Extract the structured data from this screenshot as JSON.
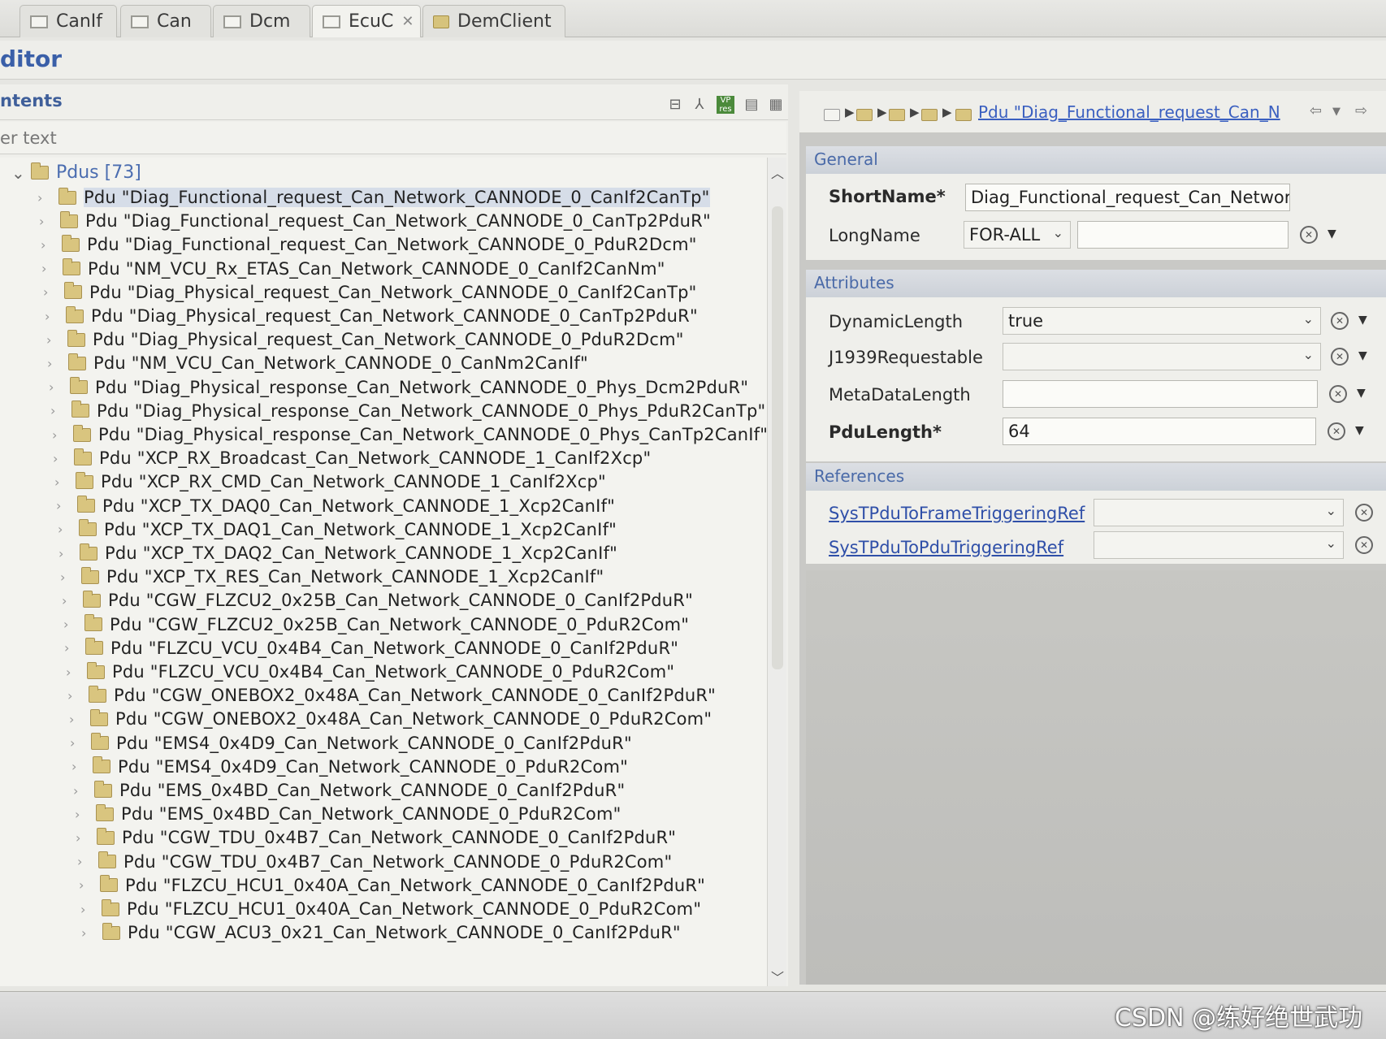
{
  "tabs": [
    {
      "label": "CanIf"
    },
    {
      "label": "Can"
    },
    {
      "label": "Dcm"
    },
    {
      "label": "EcuC"
    },
    {
      "label": "DemClient"
    }
  ],
  "editor_title": "ditor",
  "left_panel": {
    "title": "ntents",
    "filter_placeholder": "er text",
    "root": {
      "label": "Pdus [73]"
    },
    "items": [
      "Pdu \"Diag_Functional_request_Can_Network_CANNODE_0_CanIf2CanTp\"",
      "Pdu \"Diag_Functional_request_Can_Network_CANNODE_0_CanTp2PduR\"",
      "Pdu \"Diag_Functional_request_Can_Network_CANNODE_0_PduR2Dcm\"",
      "Pdu \"NM_VCU_Rx_ETAS_Can_Network_CANNODE_0_CanIf2CanNm\"",
      "Pdu \"Diag_Physical_request_Can_Network_CANNODE_0_CanIf2CanTp\"",
      "Pdu \"Diag_Physical_request_Can_Network_CANNODE_0_CanTp2PduR\"",
      "Pdu \"Diag_Physical_request_Can_Network_CANNODE_0_PduR2Dcm\"",
      "Pdu \"NM_VCU_Can_Network_CANNODE_0_CanNm2CanIf\"",
      "Pdu \"Diag_Physical_response_Can_Network_CANNODE_0_Phys_Dcm2PduR\"",
      "Pdu \"Diag_Physical_response_Can_Network_CANNODE_0_Phys_PduR2CanTp\"",
      "Pdu \"Diag_Physical_response_Can_Network_CANNODE_0_Phys_CanTp2CanIf\"",
      "Pdu \"XCP_RX_Broadcast_Can_Network_CANNODE_1_CanIf2Xcp\"",
      "Pdu \"XCP_RX_CMD_Can_Network_CANNODE_1_CanIf2Xcp\"",
      "Pdu \"XCP_TX_DAQ0_Can_Network_CANNODE_1_Xcp2CanIf\"",
      "Pdu \"XCP_TX_DAQ1_Can_Network_CANNODE_1_Xcp2CanIf\"",
      "Pdu \"XCP_TX_DAQ2_Can_Network_CANNODE_1_Xcp2CanIf\"",
      "Pdu \"XCP_TX_RES_Can_Network_CANNODE_1_Xcp2CanIf\"",
      "Pdu \"CGW_FLZCU2_0x25B_Can_Network_CANNODE_0_CanIf2PduR\"",
      "Pdu \"CGW_FLZCU2_0x25B_Can_Network_CANNODE_0_PduR2Com\"",
      "Pdu \"FLZCU_VCU_0x4B4_Can_Network_CANNODE_0_CanIf2PduR\"",
      "Pdu \"FLZCU_VCU_0x4B4_Can_Network_CANNODE_0_PduR2Com\"",
      "Pdu \"CGW_ONEBOX2_0x48A_Can_Network_CANNODE_0_CanIf2PduR\"",
      "Pdu \"CGW_ONEBOX2_0x48A_Can_Network_CANNODE_0_PduR2Com\"",
      "Pdu \"EMS4_0x4D9_Can_Network_CANNODE_0_CanIf2PduR\"",
      "Pdu \"EMS4_0x4D9_Can_Network_CANNODE_0_PduR2Com\"",
      "Pdu \"EMS_0x4BD_Can_Network_CANNODE_0_CanIf2PduR\"",
      "Pdu \"EMS_0x4BD_Can_Network_CANNODE_0_PduR2Com\"",
      "Pdu \"CGW_TDU_0x4B7_Can_Network_CANNODE_0_CanIf2PduR\"",
      "Pdu \"CGW_TDU_0x4B7_Can_Network_CANNODE_0_PduR2Com\"",
      "Pdu \"FLZCU_HCU1_0x40A_Can_Network_CANNODE_0_CanIf2PduR\"",
      "Pdu \"FLZCU_HCU1_0x40A_Can_Network_CANNODE_0_PduR2Com\"",
      "Pdu \"CGW_ACU3_0x21_Can_Network_CANNODE_0_CanIf2PduR\""
    ]
  },
  "right_panel": {
    "breadcrumb_link": "Pdu \"Diag_Functional_request_Can_N",
    "general": {
      "title": "General",
      "shortname_label": "ShortName*",
      "shortname_value": "Diag_Functional_request_Can_Network_(",
      "longname_label": "LongName",
      "longname_lang": "FOR-ALL",
      "longname_value": ""
    },
    "attributes": {
      "title": "Attributes",
      "dynamic_length_label": "DynamicLength",
      "dynamic_length_value": "true",
      "j1939_label": "J1939Requestable",
      "j1939_value": "",
      "metadata_length_label": "MetaDataLength",
      "metadata_length_value": "",
      "pdu_length_label": "PduLength*",
      "pdu_length_value": "64"
    },
    "references": {
      "title": "References",
      "frame_triggering_label": "SysTPduToFrameTriggeringRef",
      "frame_triggering_value": "",
      "pdu_triggering_label": "SysTPduToPduTriggeringRef",
      "pdu_triggering_value": ""
    }
  },
  "watermark": "CSDN @练好绝世武功",
  "icons": [
    "tab-icon",
    "folder-icon",
    "collapse-all-icon",
    "filter-icon",
    "vp-res-icon",
    "document-icon",
    "table-icon",
    "back-arrow-icon",
    "forward-arrow-icon",
    "clear-icon",
    "dropdown-icon"
  ]
}
